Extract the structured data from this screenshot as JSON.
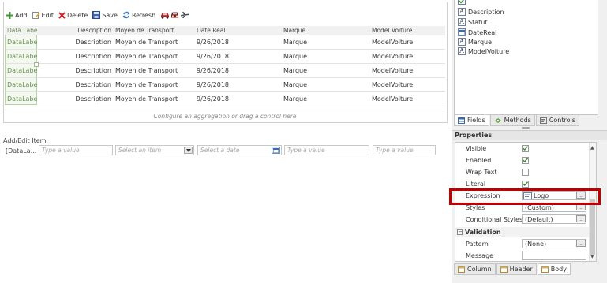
{
  "toolbar": {
    "add": "Add",
    "edit": "Edit",
    "delete": "Delete",
    "save": "Save",
    "refresh": "Refresh"
  },
  "grid": {
    "headers": [
      "Data Label",
      "Description",
      "Moyen de Transport",
      "Date Real",
      "Marque",
      "Model Voiture"
    ],
    "rows": [
      [
        "DataLabel",
        "Description",
        "Moyen de Transport",
        "9/26/2018",
        "Marque",
        "ModelVoiture"
      ],
      [
        "DataLabel",
        "Description",
        "Moyen de Transport",
        "9/26/2018",
        "Marque",
        "ModelVoiture"
      ],
      [
        "DataLabel",
        "Description",
        "Moyen de Transport",
        "9/26/2018",
        "Marque",
        "ModelVoiture"
      ],
      [
        "DataLabel",
        "Description",
        "Moyen de Transport",
        "9/26/2018",
        "Marque",
        "ModelVoiture"
      ],
      [
        "DataLabel",
        "Description",
        "Moyen de Transport",
        "9/26/2018",
        "Marque",
        "ModelVoiture"
      ]
    ],
    "aggregation_hint": "Configure an aggregation or drag a control here"
  },
  "add_edit": {
    "label": "Add/Edit Item:",
    "first_value": "[DataLa...",
    "placeholders": [
      "Type a value",
      "Select an item",
      "Select a date",
      "Type a value",
      "Type a value"
    ]
  },
  "fields_panel": {
    "items": [
      "Description",
      "Statut",
      "DateReal",
      "Marque",
      "ModelVoiture"
    ],
    "tabs": [
      "Fields",
      "Methods",
      "Controls"
    ]
  },
  "properties": {
    "title": "Properties",
    "rows": [
      {
        "name": "Visible",
        "type": "check",
        "checked": true
      },
      {
        "name": "Enabled",
        "type": "check",
        "checked": true
      },
      {
        "name": "Wrap Text",
        "type": "check",
        "checked": false
      },
      {
        "name": "Literal",
        "type": "check",
        "checked": true
      },
      {
        "name": "Expression",
        "type": "expr",
        "value": "Logo"
      },
      {
        "name": "Styles",
        "type": "value",
        "value": "(Custom)"
      },
      {
        "name": "Conditional Styles",
        "type": "value",
        "value": "(Default)"
      }
    ],
    "section_validation": "Validation",
    "validation_rows": [
      {
        "name": "Pattern",
        "value": "(None)"
      },
      {
        "name": "Message",
        "value": ""
      }
    ],
    "ellipsis": "...",
    "bottom_tabs": [
      "Column",
      "Header",
      "Body"
    ]
  }
}
